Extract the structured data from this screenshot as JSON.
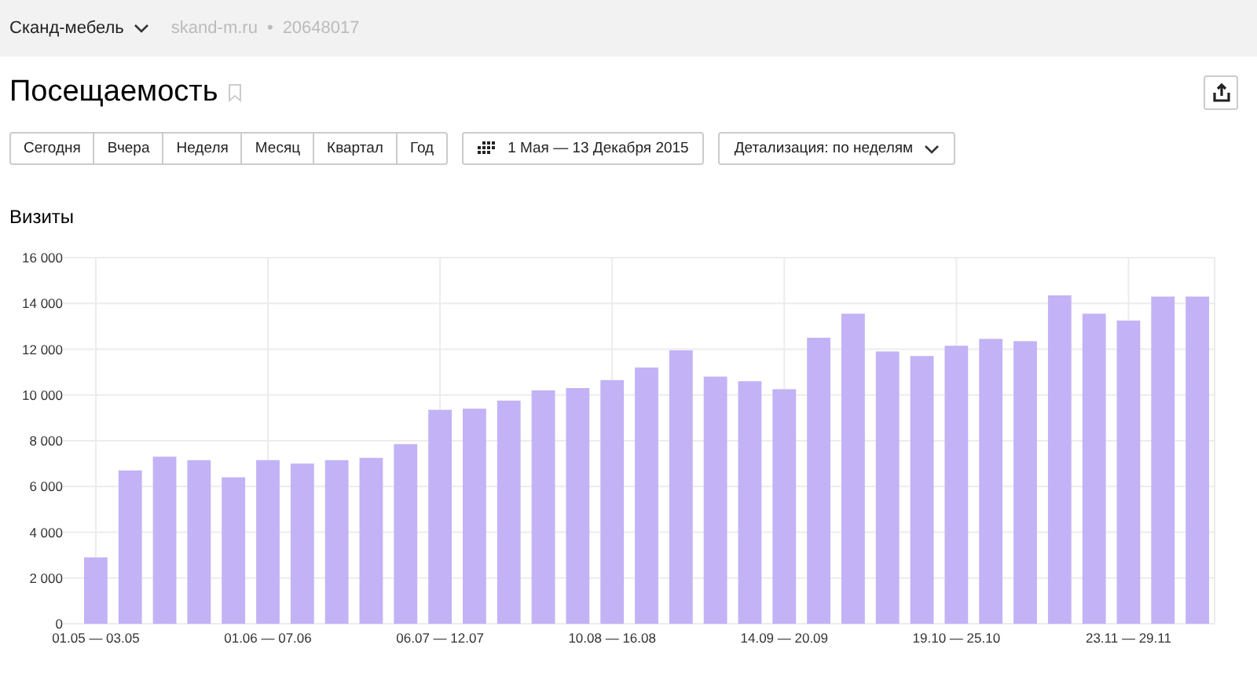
{
  "header": {
    "counter_name": "Сканд-мебель",
    "site": "skand-m.ru",
    "separator": "•",
    "counter_id": "20648017"
  },
  "page": {
    "title": "Посещаемость"
  },
  "periods": [
    {
      "label": "Сегодня",
      "selected": false
    },
    {
      "label": "Вчера",
      "selected": false
    },
    {
      "label": "Неделя",
      "selected": false
    },
    {
      "label": "Месяц",
      "selected": false
    },
    {
      "label": "Квартал",
      "selected": false
    },
    {
      "label": "Год",
      "selected": false
    }
  ],
  "date_range": "1 Мая — 13 Декабря 2015",
  "detail": "Детализация: по неделям",
  "chart": {
    "title": "Визиты",
    "chart_data": {
      "type": "bar",
      "color": "#c3b2f5",
      "values": [
        2900,
        6700,
        7300,
        7150,
        6400,
        7150,
        7000,
        7150,
        7250,
        7850,
        9350,
        9400,
        9750,
        10200,
        10300,
        10650,
        11200,
        11950,
        10800,
        10600,
        10250,
        12500,
        13550,
        11900,
        11700,
        12150,
        12450,
        12350,
        14350,
        13550,
        13250,
        14300,
        14300
      ],
      "ylim": [
        0,
        16000
      ],
      "yticks": [
        {
          "value": 0,
          "label": "0"
        },
        {
          "value": 2000,
          "label": "2 000"
        },
        {
          "value": 4000,
          "label": "4 000"
        },
        {
          "value": 6000,
          "label": "6 000"
        },
        {
          "value": 8000,
          "label": "8 000"
        },
        {
          "value": 10000,
          "label": "10 000"
        },
        {
          "value": 12000,
          "label": "12 000"
        },
        {
          "value": 14000,
          "label": "14 000"
        },
        {
          "value": 16000,
          "label": "16 000"
        }
      ],
      "grid": true,
      "categories": [
        "01.05 — 03.05",
        null,
        null,
        null,
        null,
        "01.06 — 07.06",
        null,
        null,
        null,
        null,
        "06.07 — 12.07",
        null,
        null,
        null,
        null,
        "10.08 — 16.08",
        null,
        null,
        null,
        null,
        "14.09 — 20.09",
        null,
        null,
        null,
        null,
        "19.10 — 25.10",
        null,
        null,
        null,
        null,
        "23.11 — 29.11",
        null,
        null
      ]
    }
  }
}
